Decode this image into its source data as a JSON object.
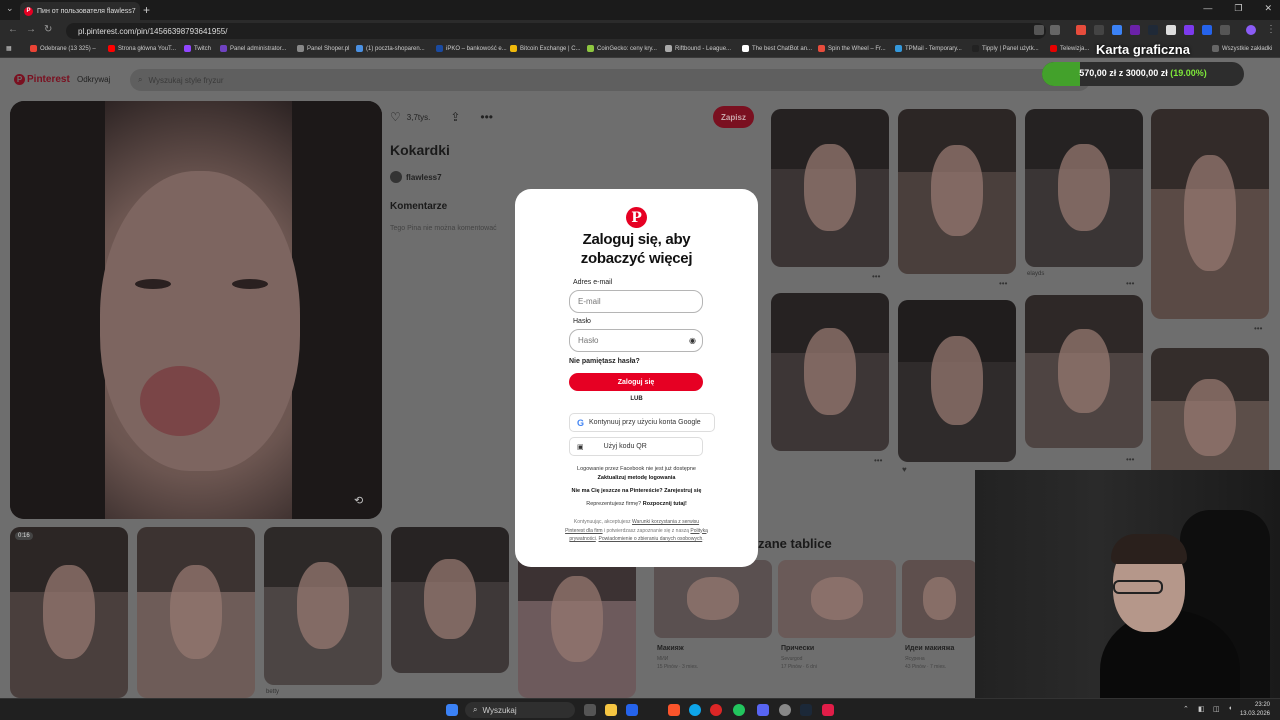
{
  "browser": {
    "tab_title": "Пин от пользователя flawless7",
    "url": "pl.pinterest.com/pin/14566398793641955/",
    "bookmarks": [
      {
        "label": "Odebrane (13 325) –",
        "color": "#ea4335"
      },
      {
        "label": "Strona główna YouT...",
        "color": "#ff0000"
      },
      {
        "label": "Twitch",
        "color": "#9146ff"
      },
      {
        "label": "Panel administrator...",
        "color": "#6f42c1"
      },
      {
        "label": "Panel Shoper.pl",
        "color": "#888888"
      },
      {
        "label": "(1) poczta-shoparen...",
        "color": "#4a90e2"
      },
      {
        "label": "iPKO – bankowość e...",
        "color": "#1a4aa0"
      },
      {
        "label": "Bitcoin Exchange | C...",
        "color": "#f0b90b"
      },
      {
        "label": "CoinGecko: ceny kry...",
        "color": "#8dc63f"
      },
      {
        "label": "Riftbound - League...",
        "color": "#aaaaaa"
      },
      {
        "label": "The best ChatBot an...",
        "color": "#ffffff"
      },
      {
        "label": "Spin the Wheel – Fr...",
        "color": "#e74c3c"
      },
      {
        "label": "TPMail - Temporary...",
        "color": "#3498db"
      },
      {
        "label": "Tipply | Panel użytk...",
        "color": "#222222"
      },
      {
        "label": "Telewizja...",
        "color": "#e60000"
      }
    ],
    "all_bookmarks": "Wszystkie zakładki"
  },
  "pinterest": {
    "logo": "Pinterest",
    "discover": "Odkrywaj",
    "search_placeholder": "Wyszukaj style fryzur",
    "likes": "3,7tys.",
    "save": "Zapisz",
    "pin_title": "Kokardki",
    "author": "flawless7",
    "comments_heading": "Komentarze",
    "comments_disabled": "Tego Pina nie można komentować",
    "video_time": "0:16",
    "thumb_labels": {
      "elayds": "elayds",
      "betty": "betty"
    },
    "boards_heading": "zane tablice",
    "boards": [
      {
        "title": "Макияж",
        "author": "МИИ",
        "meta": "15 Pinów · 3 mies."
      },
      {
        "title": "Прически",
        "author": "Sevurgod",
        "meta": "17 Pinów · 6 dni"
      },
      {
        "title": "Идеи макияжа",
        "author": "Ясурена",
        "meta": "43 Pinów · 7 mies."
      }
    ]
  },
  "modal": {
    "title_line1": "Zaloguj się, aby",
    "title_line2": "zobaczyć więcej",
    "email_label": "Adres e-mail",
    "email_placeholder": "E-mail",
    "password_label": "Hasło",
    "password_placeholder": "Hasło",
    "forgot": "Nie pamiętasz hasła?",
    "login_button": "Zaloguj się",
    "or": "LUB",
    "google_button": "Kontynuuj przy użyciu konta Google",
    "qr_button": "Użyj kodu QR",
    "facebook_note": "Logowanie przez Facebook nie jest już dostępne",
    "facebook_action": "Zaktualizuj metodę logowania",
    "signup": "Nie ma Cię jeszcze na Pintereście? Zarejestruj się",
    "business_prefix": "Reprezentujesz firmę?",
    "business_link": "Rozpocznij tutaj!",
    "legal_1": "Kontynuując, akceptujesz",
    "legal_link1": "Warunki korzystania z serwisu Pinterest dla firm",
    "legal_2": "i potwierdzasz zapoznanie się z naszą",
    "legal_link2": "Polityką prywatności",
    "legal_3": ".",
    "legal_link3": "Powiadomienie o zbieraniu danych osobowych",
    "legal_4": "."
  },
  "overlay": {
    "title": "Karta graficzna",
    "progress_text": "570,00 zł z 3000,00 zł",
    "progress_pct": "(19.00%)",
    "progress_fraction": 0.19
  },
  "taskbar": {
    "search": "Wyszukaj",
    "time": "23:20",
    "date": "13.03.2026"
  },
  "colors": {
    "pinterest_red": "#e60023",
    "overlay_green": "#43a12b"
  }
}
